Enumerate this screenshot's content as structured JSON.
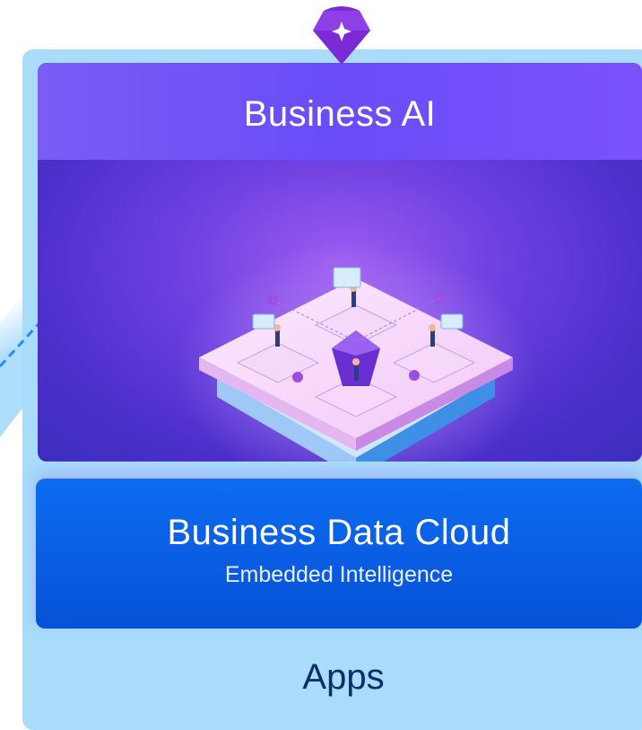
{
  "layers": {
    "business_ai": {
      "title": "Business AI"
    },
    "business_data_cloud": {
      "title": "Business Data Cloud",
      "subtitle": "Embedded Intelligence"
    },
    "apps": {
      "title": "Apps"
    }
  },
  "icons": {
    "top": "gem-sparkle-icon",
    "arrow": "dashed-arrow-icon",
    "illustration": "isometric-platform-illustration"
  },
  "colors": {
    "outer_panel": "#a9dcfb",
    "ai_header": "#6a4cf8",
    "ai_body": "#4a2fc9",
    "data_cloud": "#0a5de3",
    "apps_text": "#0c2c6e",
    "gem": "#7a2bd6",
    "arrow": "#2a8ef0"
  }
}
